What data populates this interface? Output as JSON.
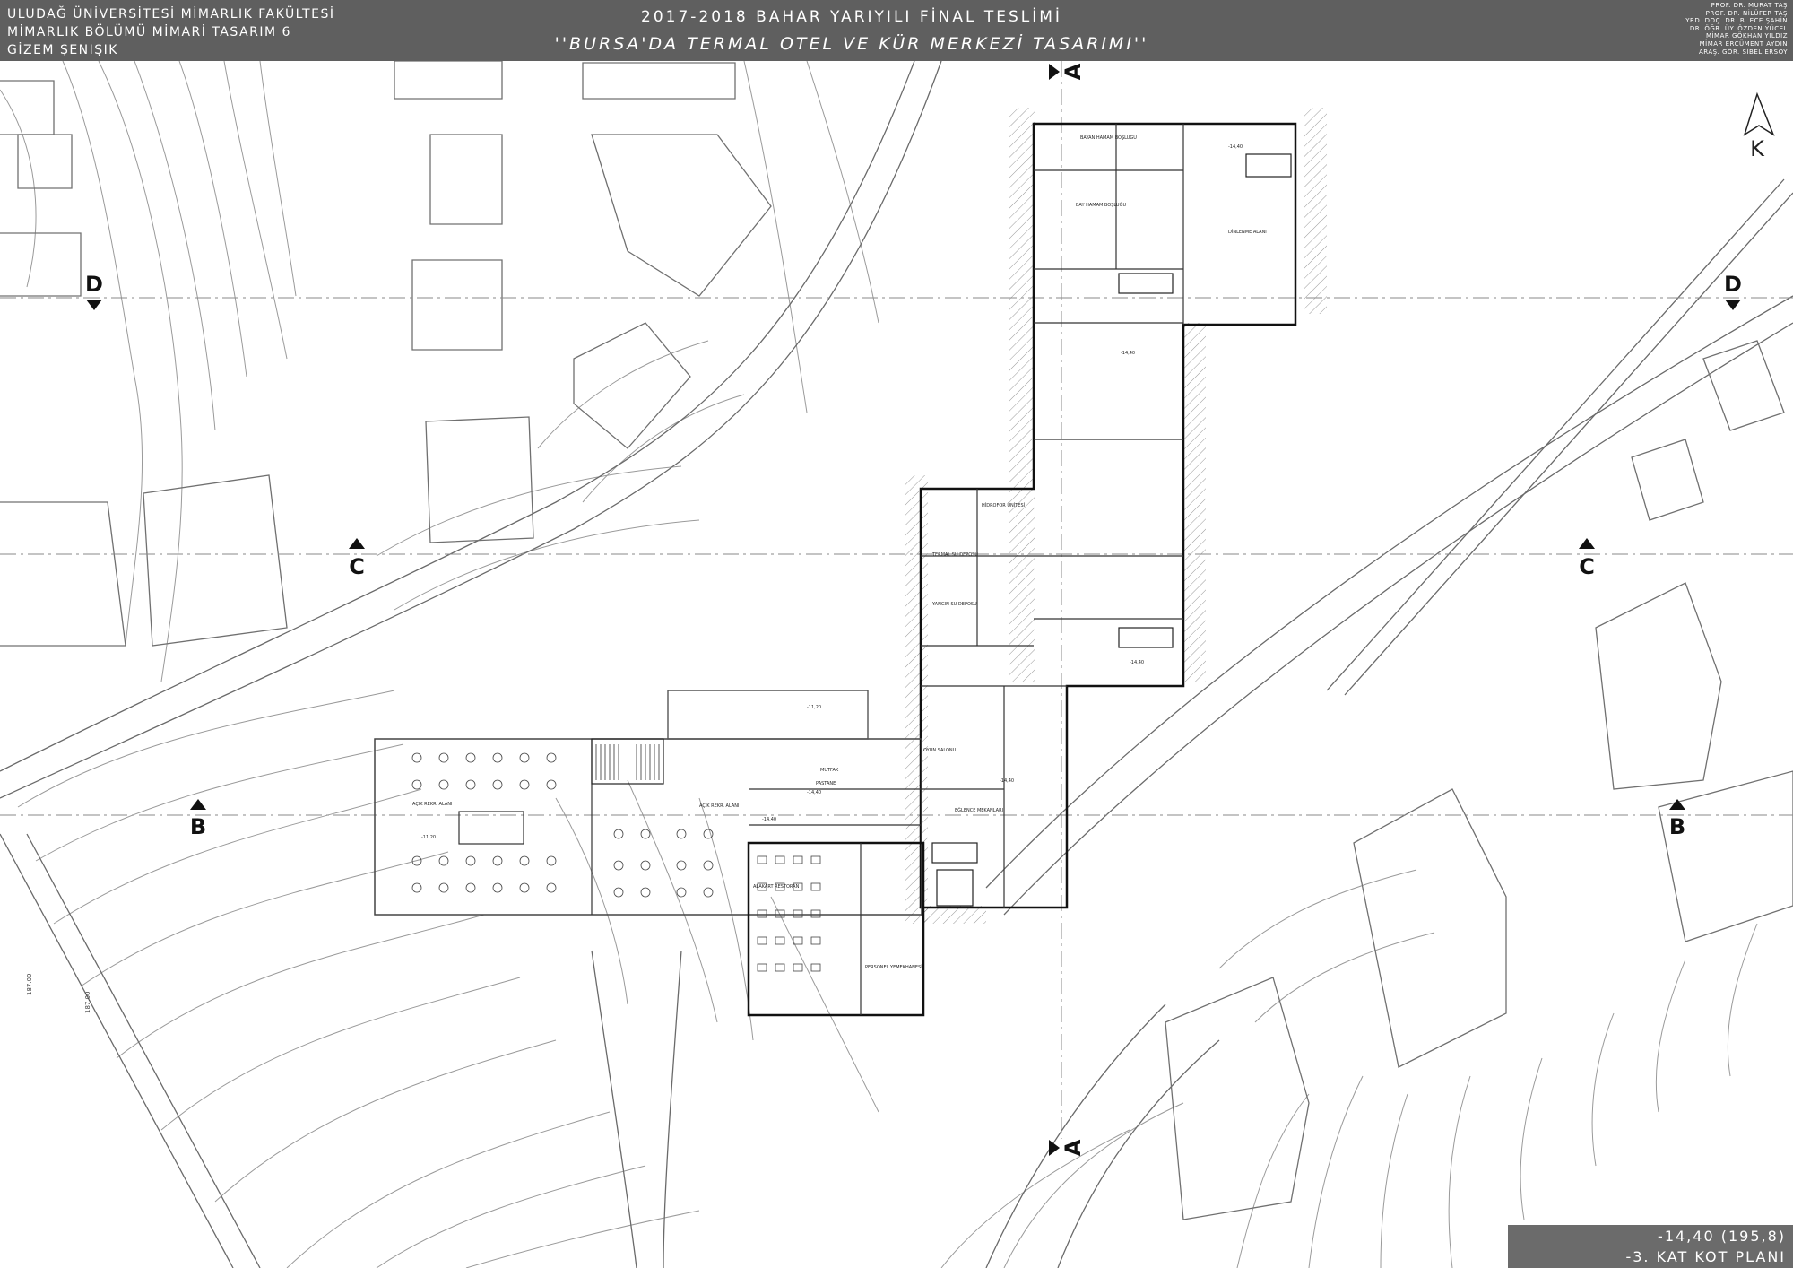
{
  "header": {
    "left_lines": [
      "ULUDAĞ ÜNİVERSİTESİ MİMARLIK FAKÜLTESİ",
      "MİMARLIK BÖLÜMÜ MİMARİ TASARIM 6",
      "GİZEM ŞENIŞIK"
    ],
    "title": "2017-2018 BAHAR YARIYILI FİNAL TESLİMİ",
    "subtitle": "''BURSA'DA TERMAL OTEL VE  KÜR MERKEZİ TASARIMI''",
    "instructors": [
      "PROF. DR. MURAT TAŞ",
      "PROF. DR. NİLÜFER TAŞ",
      "YRD. DOÇ. DR. B. ECE ŞAHİN",
      "DR. ÖĞR. ÜY. ÖZDEN YÜCEL",
      "MİMAR GÖKHAN YILDIZ",
      "MİMAR ERCÜMENT AYDIN",
      "ARAŞ. GÖR. SİBEL ERSOY"
    ]
  },
  "north": {
    "label": "K"
  },
  "section_markers": {
    "a": "A",
    "b": "B",
    "c": "C",
    "d": "D"
  },
  "rooms": {
    "bayan_hamam": "BAYAN HAMAM BOŞLUĞU",
    "bay_hamam": "BAY HAMAM BOŞLUĞU",
    "dinlenme_alani": "DİNLENME ALANI",
    "hidrofor": "HİDROFOR ÜNİTESİ",
    "termal_depo": "TERMAL SU DEPOSU",
    "yangin_depo": "YANGIN SU DEPOSU",
    "oyun_salonu": "OYUN SALONU",
    "pastane": "PASTANE",
    "mutfak": "MUTFAK",
    "eglence": "EĞLENCE MEKANLARI",
    "acik_rekreasyon": "AÇIK REKR. ALANI",
    "alakart": "ALAKART RESTORAN",
    "personel": "PERSONEL YEMEKHANESİ"
  },
  "elevations": {
    "main": "-14,40",
    "upper": "-11,20"
  },
  "contours": {
    "c1": "187.00",
    "c2": "187.00"
  },
  "title_block": {
    "line1": "-14,40 (195,8)",
    "line2": "-3. KAT KOT PLANI"
  }
}
